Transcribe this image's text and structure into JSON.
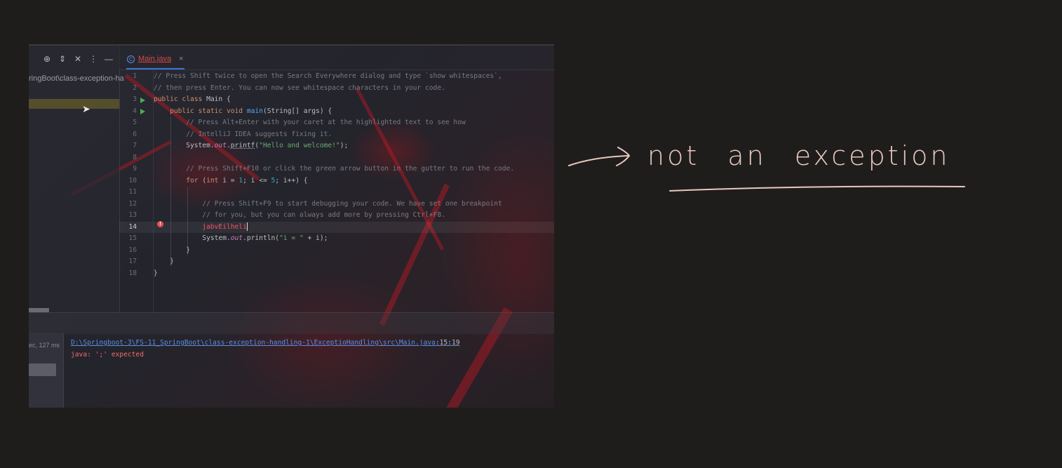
{
  "left_panel": {
    "toolbar_icons": [
      "crosshair-icon",
      "expand-collapse-icon",
      "collapse-all-icon",
      "more-vertical-icon",
      "minimize-icon"
    ],
    "path_text": "ringBoot\\class-exception-ha",
    "scroll_label": ""
  },
  "editor": {
    "tab": {
      "label": "Main.java",
      "icon": "java-class-icon",
      "close": "×"
    },
    "line_numbers": [
      "1",
      "2",
      "3",
      "4",
      "5",
      "6",
      "7",
      "8",
      "9",
      "10",
      "11",
      "12",
      "13",
      "14",
      "15",
      "16",
      "17",
      "18"
    ],
    "code": {
      "l1": "// Press Shift twice to open the Search Everywhere dialog and type `show whitespaces`,",
      "l2": "// then press Enter. You can now see whitespace characters in your code.",
      "l3_kw": "public class ",
      "l3_name": "Main {",
      "l4_kw": "    public static void ",
      "l4_fn": "main",
      "l4_rest": "(String[] args) {",
      "l5": "        // Press Alt+Enter with your caret at the highlighted text to see how",
      "l6": "        // IntelliJ IDEA suggests fixing it.",
      "l7_a": "        System.",
      "l7_out": "out",
      "l7_dot": ".",
      "l7_fn": "printf",
      "l7_open": "(",
      "l7_str": "\"Hello and welcome!\"",
      "l7_close": ");",
      "l9": "        // Press Shift+F10 or click the green arrow button in the gutter to run the code.",
      "l10_kw": "        for ",
      "l10_a": "(",
      "l10_int": "int ",
      "l10_b": "i = ",
      "l10_n1": "1",
      "l10_c": "; i <= ",
      "l10_n2": "5",
      "l10_d": "; i++) {",
      "l12": "            // Press Shift+F9 to start debugging your code. We have set one breakpoint",
      "l13": "            // for you, but you can always add more by pressing Ctrl+F8.",
      "l14_indent": "            ",
      "l14_err": "jabvEilheli",
      "l15_a": "            System.",
      "l15_out": "out",
      "l15_b": ".println(",
      "l15_str": "\"i = \"",
      "l15_c": " + i);",
      "l16": "        }",
      "l17": "    }",
      "l18": "}"
    }
  },
  "console": {
    "build_time": "ec, 127 ms",
    "error_path": "D:\\Springboot-3\\FS-11_SpringBoot\\class-exception-handling-1\\ExceptioHandling\\src\\Main.java",
    "error_position": ":15:19",
    "error_message": "java: ';' expected"
  },
  "annotation": {
    "text": "not an exception",
    "color": "#e9c8c0"
  },
  "colors": {
    "background": "#1e1d1b",
    "error_red": "#f75464",
    "link_blue": "#5b8fe6",
    "run_green": "#4caf50",
    "tab_underline": "#3d74d9"
  }
}
